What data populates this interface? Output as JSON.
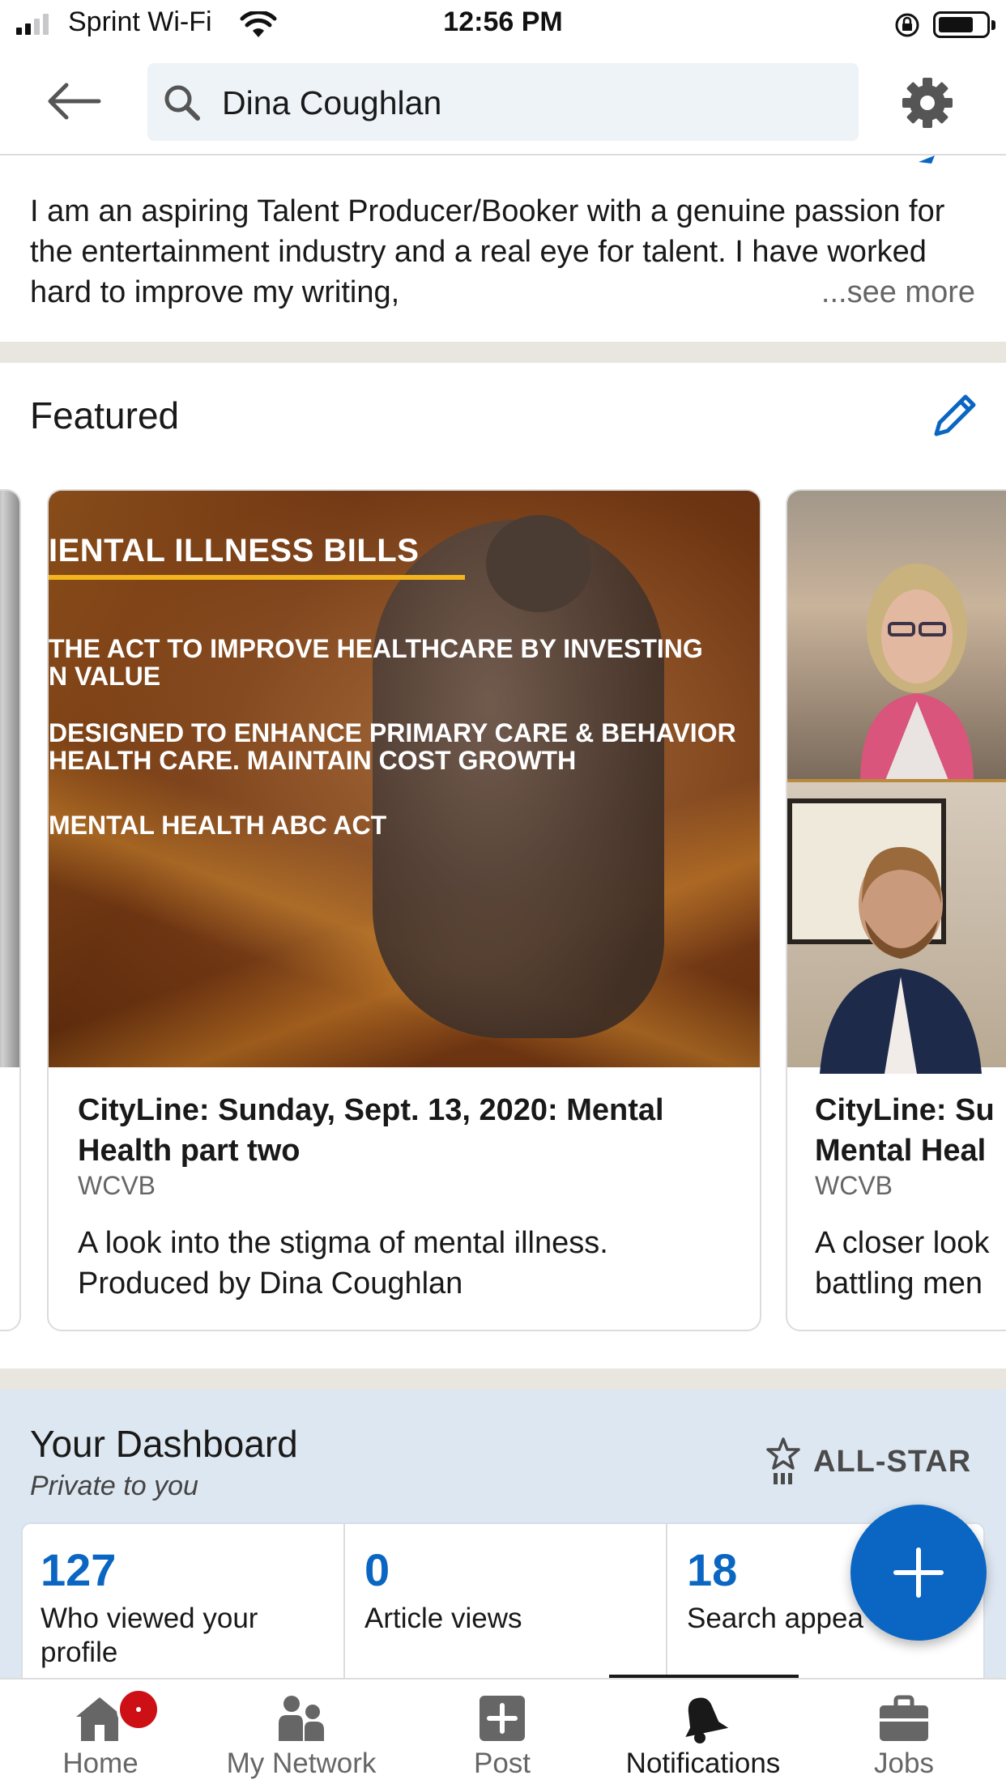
{
  "status_bar": {
    "carrier": "Sprint Wi-Fi",
    "time": "12:56 PM"
  },
  "search": {
    "query": "Dina Coughlan"
  },
  "about": {
    "text": "I am an aspiring Talent Producer/Booker with a genuine passion for the entertainment industry and a real eye for talent. I have worked hard to improve my writing,",
    "see_more": "...see more"
  },
  "featured": {
    "title": "Featured",
    "items": [
      {
        "overlay_title": "IENTAL ILLNESS BILLS",
        "overlay_lines": [
          "THE ACT TO IMPROVE HEALTHCARE BY INVESTING",
          "N VALUE",
          "DESIGNED TO ENHANCE PRIMARY CARE & BEHAVIOR",
          "HEALTH CARE. MAINTAIN COST GROWTH",
          "MENTAL HEALTH ABC ACT"
        ],
        "title": "CityLine: Sunday, Sept. 13, 2020: Mental Health part two",
        "source": "WCVB",
        "description": "A look into the stigma of mental illness. Produced by Dina Coughlan"
      },
      {
        "title_line1": "CityLine: Su",
        "title_line2": "Mental Heal",
        "source": "WCVB",
        "desc_line1": "A closer look",
        "desc_line2": "battling men"
      }
    ]
  },
  "dashboard": {
    "title": "Your Dashboard",
    "subtitle": "Private to you",
    "level": "ALL-STAR",
    "metrics": [
      {
        "value": "127",
        "label": "Who viewed your profile"
      },
      {
        "value": "0",
        "label": "Article views"
      },
      {
        "value": "18",
        "label": "Search appea"
      }
    ]
  },
  "nav": {
    "items": [
      {
        "label": "Home",
        "icon": "home-icon"
      },
      {
        "label": "My Network",
        "icon": "network-icon"
      },
      {
        "label": "Post",
        "icon": "post-icon"
      },
      {
        "label": "Notifications",
        "icon": "bell-icon"
      },
      {
        "label": "Jobs",
        "icon": "briefcase-icon"
      }
    ],
    "active": "Notifications"
  },
  "colors": {
    "accent": "#0a66c2",
    "badge": "#cc1016",
    "section_separator": "#e9e5df",
    "dashboard_bg": "#dde7f1"
  }
}
